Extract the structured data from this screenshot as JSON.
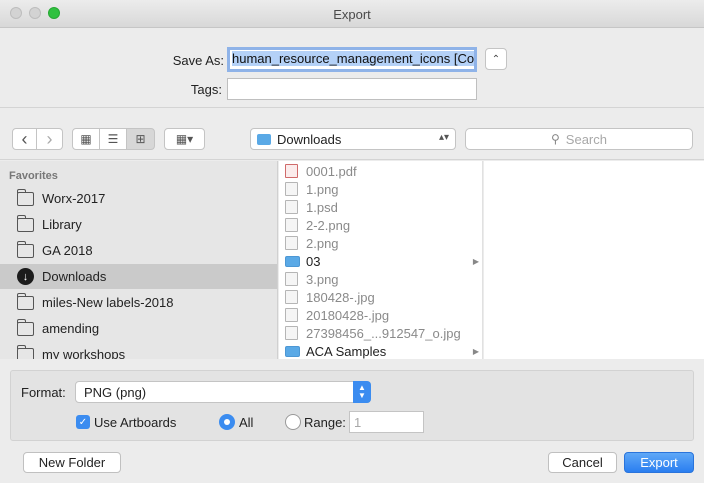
{
  "window": {
    "title": "Export"
  },
  "save": {
    "save_as_label": "Save As:",
    "filename": "human_resource_management_icons [Co",
    "tags_label": "Tags:",
    "tags_value": "",
    "expand_symbol": "⌃"
  },
  "toolbar": {
    "back_symbol": "‹",
    "forward_symbol": "›",
    "view_icons_symbol": "▦",
    "view_list_symbol": "☰",
    "view_columns_symbol": "⊞",
    "view_gallery_symbol": "▦▾",
    "location": "Downloads",
    "location_stepper": "▴▾",
    "search_placeholder": "Search",
    "search_symbol": "⚲"
  },
  "sidebar": {
    "heading": "Favorites",
    "items": [
      {
        "label": "Worx-2017",
        "selected": false
      },
      {
        "label": "Library",
        "selected": false
      },
      {
        "label": "GA 2018",
        "selected": false
      },
      {
        "label": "Downloads",
        "selected": true
      },
      {
        "label": "miles-New labels-2018",
        "selected": false
      },
      {
        "label": "amending",
        "selected": false
      },
      {
        "label": "my workshops",
        "selected": false
      }
    ]
  },
  "files": [
    {
      "name": "0001.pdf",
      "kind": "pdf"
    },
    {
      "name": "1.png",
      "kind": "file"
    },
    {
      "name": "1.psd",
      "kind": "file"
    },
    {
      "name": "2-2.png",
      "kind": "file"
    },
    {
      "name": "2.png",
      "kind": "file"
    },
    {
      "name": "03",
      "kind": "folder"
    },
    {
      "name": "3.png",
      "kind": "file"
    },
    {
      "name": "180428-.jpg",
      "kind": "file"
    },
    {
      "name": "20180428-.jpg",
      "kind": "file"
    },
    {
      "name": "27398456_...912547_o.jpg",
      "kind": "file"
    },
    {
      "name": "ACA Samples",
      "kind": "folder"
    }
  ],
  "options": {
    "format_label": "Format:",
    "format_value": "PNG (png)",
    "use_artboards_label": "Use Artboards",
    "use_artboards_checked": true,
    "all_label": "All",
    "range_label": "Range:",
    "range_value": "1",
    "selected_scope": "All"
  },
  "buttons": {
    "new_folder": "New Folder",
    "cancel": "Cancel",
    "export": "Export"
  },
  "colors": {
    "accent": "#3b8cf0",
    "selection": "#b4d1f7",
    "folder": "#5aa9e6"
  }
}
